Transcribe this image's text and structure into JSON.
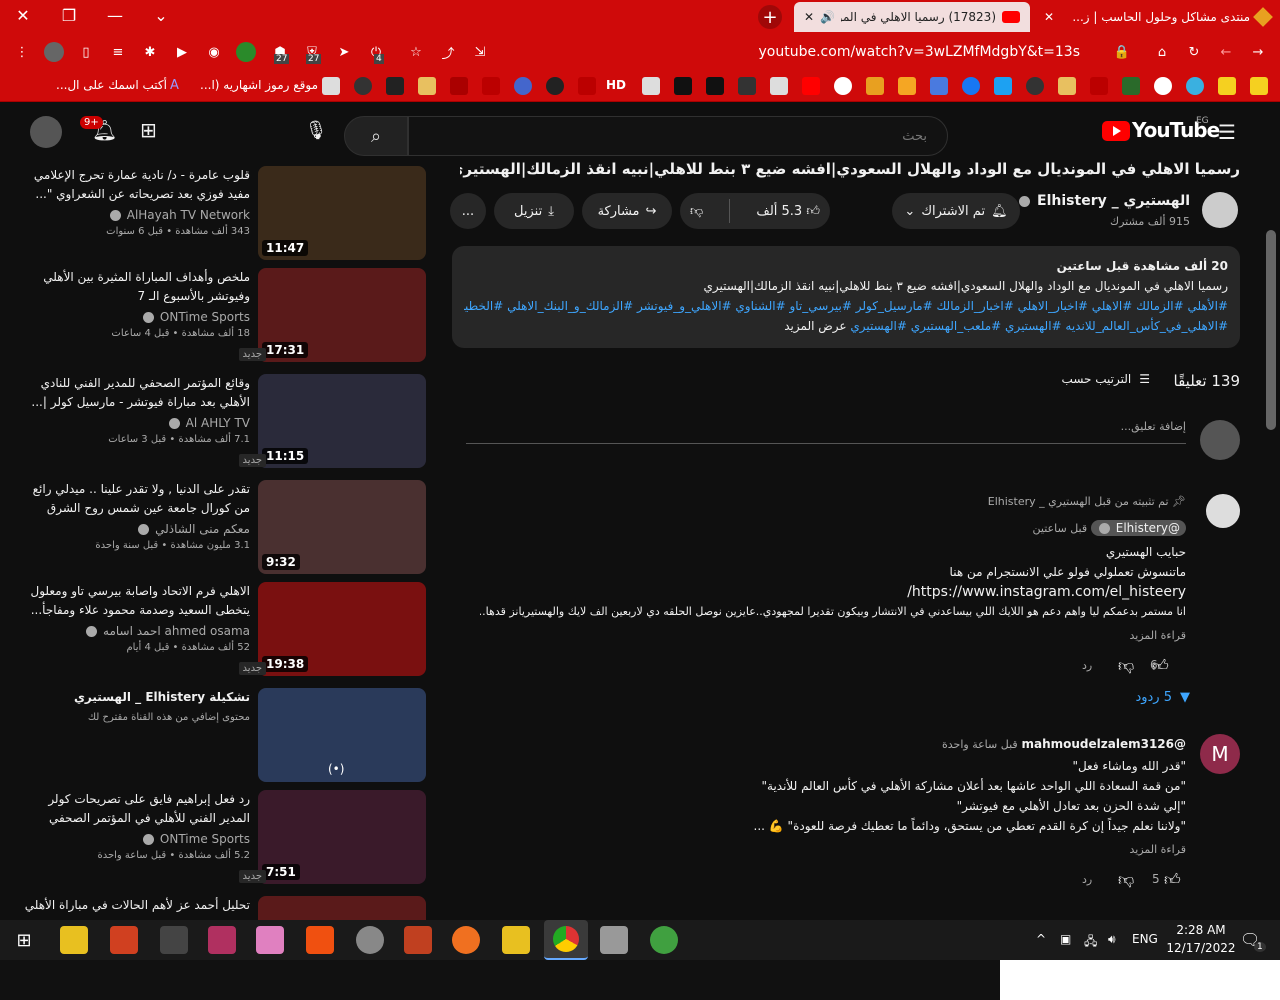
{
  "browser": {
    "tabs": [
      {
        "label": "(17823) رسميا الاهلي في الموا",
        "active": true
      },
      {
        "label": "منتدى مشاكل وحلول الحاسب | ز...",
        "active": false
      }
    ],
    "url": "youtube.com/watch?v=3wLZMfMdgbY&t=13s",
    "extension_badges": [
      "27",
      "27",
      "4"
    ],
    "bookmarks": {
      "text_1": "أكتب اسمك على ال...",
      "text_2": "موقع رموز اشهاريه (ا...",
      "hd": "HD"
    }
  },
  "youtube": {
    "logo_text": "YouTube",
    "region": "EG",
    "search_placeholder": "بحث",
    "notifications_count": "9+",
    "video": {
      "title": "رسميا الاهلي في المونديال مع الوداد والهلال السعودي|افشه ضيع ٣ بنط للاهلي|نبيه انقذ الزمالك|الهستيري",
      "channel_name": "الهستيري _ Elhistery",
      "subscribers": "915 ألف مشترك",
      "subscribe_label": "تم الاشتراك",
      "likes": "5.3 ألف",
      "share_label": "مشاركة",
      "download_label": "تنزيل",
      "more_label": "..."
    },
    "description": {
      "views": "20 ألف مشاهدة  قبل ساعتين",
      "line1": "رسميا الاهلي في المونديال مع الوداد والهلال السعودي|افشه ضيع ٣ بنط للاهلي|نبيه انقذ الزمالك|الهستيري",
      "hashtags1": "#الأهلي #الزمالك #الاهلي #اخبار_الاهلي #اخبار_الزمالك #مارسيل_كولر #بيرسي_تاو  #الشناوي #الاهلي_و_فيوتشر #الزمالك_و_البنك_الاهلي #الخطيب",
      "hashtags2": "#الاهلي_في_كأس_العالم_للانديه #الهستيري #ملعب_الهستيري #الهستيري",
      "show_more": "عرض المزيد"
    },
    "comments_header": {
      "count": "139 تعليقًا",
      "sort_label": "الترتيب حسب",
      "add_placeholder": "إضافة تعليق..."
    },
    "comments": [
      {
        "pinned_label": "تم تثبيته من قبل الهستيري _ Elhistery",
        "author": "@Elhistery",
        "time": "قبل ساعتين",
        "lines": [
          "حبايب الهستيري",
          "ماتنسوش تعملولي فولو علي الانستجرام من هنا"
        ],
        "link": "https://www.instagram.com/el_histeery/",
        "line_after": "انا مستمر بدعمكم ليا واهم دعم هو اللايك اللي بيساعدني في الانتشار وبيكون تقديرا لمجهودي..عايزين نوصل الحلقه دي لاربعين الف لايك والهستيريانز قدها...",
        "read_more": "قراءة المزيد",
        "likes": "6",
        "reply_label": "رد",
        "replies": "5 ردود"
      },
      {
        "avatar_letter": "M",
        "author": "@mahmoudelzalem3126",
        "time": "قبل ساعة واحدة",
        "lines": [
          "\"قدر الله وماشاء فعل\"",
          "\"من قمة السعادة اللي الواحد عاشها بعد أعلان مشاركة الأهلي في كأس العالم للأندية\"",
          "\"إلي شدة الحزن بعد تعادل الأهلي مع فيوتشر\"",
          "\"ولاننا نعلم جيداً إن كرة القدم تعطي من يستحق، ودائماً ما تعطيك فرصة للعودة\" 💪 ..."
        ],
        "read_more": "قراءة المزيد",
        "likes": "5",
        "reply_label": "رد"
      }
    ],
    "related": [
      {
        "title": "قلوب عامرة - د/ نادية عمارة تحرج الإعلامي مفيد فوزي بعد تصريحاته عن الشعراوي \"...",
        "channel": "AlHayah TV Network",
        "meta": "343 ألف مشاهدة  •  قبل 6 سنوات",
        "duration": "11:47",
        "badge": "",
        "color": "#3a2a1a"
      },
      {
        "title": "ملخص وأهداف المباراة المثيرة بين الأهلي وفيوتشر بالأسبوع الـ 7",
        "channel": "ONTime Sports",
        "meta": "18 ألف مشاهدة  •  قبل 4 ساعات",
        "duration": "17:31",
        "badge": "جديد",
        "color": "#5a1a1a"
      },
      {
        "title": "وقائع المؤتمر الصحفي للمدير الفني للنادي الأهلي بعد مباراة فيوتشر - مارسيل كولر |...",
        "channel": "Al AHLY TV",
        "meta": "7.1 ألف مشاهدة  •  قبل 3 ساعات",
        "duration": "11:15",
        "badge": "جديد",
        "color": "#2a2a3a"
      },
      {
        "title": "تقدر على الدنيا , ولا تقدر علينا .. ميدلي رائع من كورال جامعة عين شمس روح الشرق",
        "channel": "معكم منى الشاذلي",
        "meta": "3.1 مليون مشاهدة  •  قبل سنة واحدة",
        "duration": "9:32",
        "badge": "",
        "color": "#4a3030"
      },
      {
        "title": "الاهلي فرم الاتحاد واصابة بيرسي تاو ومعلول يتخطى السعيد وصدمة محمود علاء ومفاجأ...",
        "channel": "ahmed osama احمد اسامه",
        "meta": "52 ألف مشاهدة  •  قبل 4 أيام",
        "duration": "19:38",
        "badge": "جديد",
        "color": "#7a1010"
      },
      {
        "title": "تشكيلة Elhistery _ الهستيري",
        "channel": "محتوى إضافي من هذه القناة مقترح لك",
        "meta": "",
        "duration": "",
        "badge": "",
        "color": "#2a3a5a"
      },
      {
        "title": "رد فعل إبراهيم فايق على تصريحات كولر المدير الفني للأهلي في المؤتمر الصحفي عق...",
        "channel": "ONTime Sports",
        "meta": "5.2 ألف مشاهدة  •  قبل ساعة واحدة",
        "duration": "7:51",
        "badge": "جديد",
        "color": "#3a1a2a"
      },
      {
        "title": "تحليل أحمد عز لأهم الحالات في مباراة الأهلي",
        "channel": "",
        "meta": "",
        "duration": "",
        "badge": "",
        "color": "#5a1a1a"
      }
    ]
  },
  "taskbar": {
    "lang": "ENG",
    "time": "2:28 AM",
    "date": "12/17/2022",
    "notif_count": "1"
  }
}
